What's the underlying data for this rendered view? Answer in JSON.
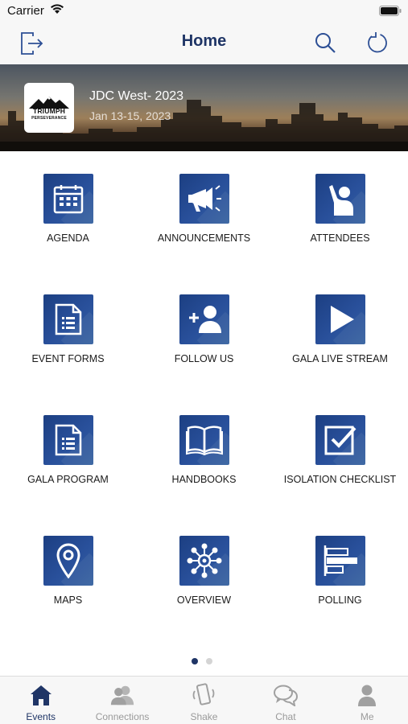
{
  "status": {
    "carrier": "Carrier"
  },
  "nav": {
    "title": "Home",
    "icons": [
      "logout-icon",
      "search-icon",
      "refresh-icon"
    ]
  },
  "event": {
    "title": "JDC West- 2023",
    "dates": "Jan 13-15, 2023",
    "logo_text": [
      "TRIUMPH",
      "PERSEVERANCE"
    ]
  },
  "grid": {
    "tiles": [
      {
        "label": "AGENDA",
        "icon": "calendar-icon"
      },
      {
        "label": "ANNOUNCEMENTS",
        "icon": "megaphone-icon"
      },
      {
        "label": "ATTENDEES",
        "icon": "raised-hand-icon"
      },
      {
        "label": "EVENT FORMS",
        "icon": "document-icon"
      },
      {
        "label": "FOLLOW US",
        "icon": "add-person-icon"
      },
      {
        "label": "GALA LIVE STREAM",
        "icon": "play-icon"
      },
      {
        "label": "GALA PROGRAM",
        "icon": "document-icon"
      },
      {
        "label": "HANDBOOKS",
        "icon": "book-icon"
      },
      {
        "label": "ISOLATION CHECKLIST",
        "icon": "checkbox-icon"
      },
      {
        "label": "MAPS",
        "icon": "map-pin-icon"
      },
      {
        "label": "OVERVIEW",
        "icon": "network-icon"
      },
      {
        "label": "POLLING",
        "icon": "bar-chart-icon"
      }
    ]
  },
  "pagination": {
    "pages": 2,
    "current": 1
  },
  "tabbar": {
    "tabs": [
      {
        "label": "Events",
        "icon": "home-icon",
        "active": true
      },
      {
        "label": "Connections",
        "icon": "people-icon",
        "active": false
      },
      {
        "label": "Shake",
        "icon": "shake-phone-icon",
        "active": false
      },
      {
        "label": "Chat",
        "icon": "chat-icon",
        "active": false
      },
      {
        "label": "Me",
        "icon": "person-icon",
        "active": false
      }
    ]
  },
  "colors": {
    "primary": "#1f3566",
    "tile": "#254a93",
    "inactive": "#9a9a9a"
  }
}
